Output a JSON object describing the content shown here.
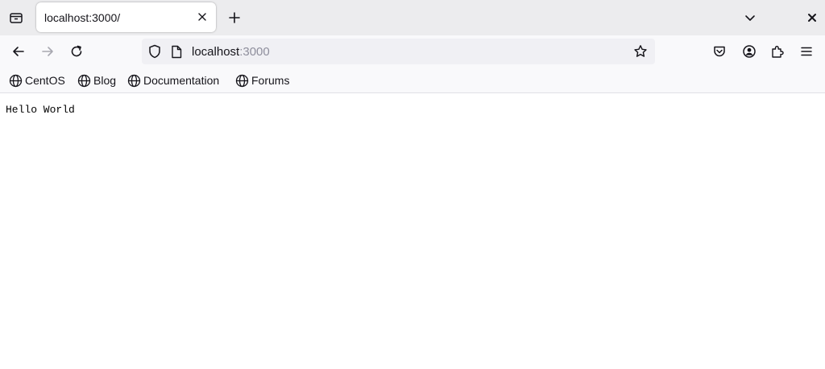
{
  "tab": {
    "title": "localhost:3000/"
  },
  "address": {
    "host": "localhost",
    "port": ":3000"
  },
  "bookmarks": [
    {
      "label": "CentOS"
    },
    {
      "label": "Blog"
    },
    {
      "label": "Documentation"
    },
    {
      "label": "Forums"
    }
  ],
  "page": {
    "text": "Hello World"
  },
  "icons": {
    "tab_list": "tab-list-icon",
    "close_tab": "close-icon",
    "new_tab": "plus-icon",
    "list_all_tabs": "chevron-down-icon",
    "close_window": "close-icon",
    "back": "arrow-left-icon",
    "forward": "arrow-right-icon",
    "reload": "reload-icon",
    "tracking": "shield-icon",
    "page_info": "page-icon",
    "bookmark": "star-icon",
    "pocket": "pocket-icon",
    "account": "account-icon",
    "extensions": "puzzle-icon",
    "menu": "hamburger-icon",
    "bookmark_item": "globe-icon"
  },
  "colors": {
    "tabbar_bg": "#ececee",
    "toolbar_bg": "#f9f9fb",
    "urlbar_bg": "#f0f0f4",
    "text": "#15141a",
    "dim_text": "#8f8f9d"
  }
}
